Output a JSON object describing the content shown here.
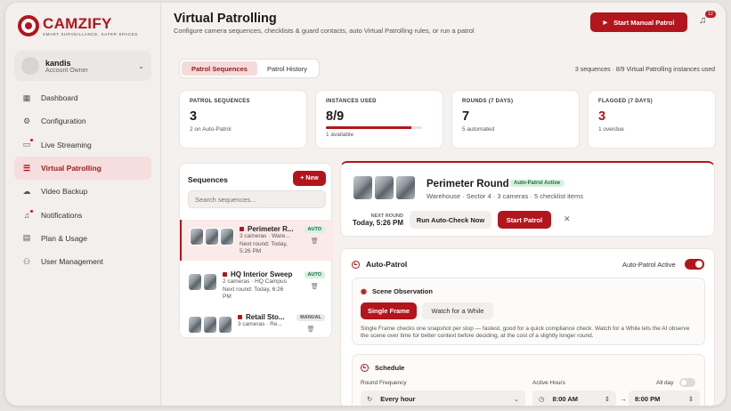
{
  "brand": {
    "name": "CAMZIFY",
    "tagline": "SMART SURVEILLANCE, SAFER SPACES"
  },
  "user": {
    "name": "kandis",
    "role": "Account Owner"
  },
  "nav": [
    {
      "label": "Dashboard",
      "icon": "grid-icon"
    },
    {
      "label": "Configuration",
      "icon": "gear-icon"
    },
    {
      "label": "Live Streaming",
      "icon": "video-icon"
    },
    {
      "label": "Virtual Patrolling",
      "icon": "stack-icon",
      "active": true
    },
    {
      "label": "Video Backup",
      "icon": "cloud-icon"
    },
    {
      "label": "Notifications",
      "icon": "bell-icon"
    },
    {
      "label": "Plan & Usage",
      "icon": "document-icon"
    },
    {
      "label": "User Management",
      "icon": "users-icon"
    }
  ],
  "header": {
    "title": "Virtual Patrolling",
    "subtitle": "Configure camera sequences, checklists & guard contacts, auto Virtual Patrolling rules, or run a patrol",
    "start_manual": "Start Manual Patrol",
    "notif_count": "12"
  },
  "tabs": [
    "Patrol Sequences",
    "Patrol History"
  ],
  "meta": "3 sequences · 8/9 Virtual Patrolling instances used",
  "stats": [
    {
      "label": "PATROL SEQUENCES",
      "value": "3",
      "sub": "2 on Auto-Patrol"
    },
    {
      "label": "INSTANCES USED",
      "value": "8/9",
      "sub": "1 available",
      "progress": 0.89
    },
    {
      "label": "ROUNDS (7 DAYS)",
      "value": "7",
      "sub": "5 automated"
    },
    {
      "label": "FLAGGED (7 DAYS)",
      "value": "3",
      "sub": "1 overdue"
    }
  ],
  "sequences": {
    "title": "Sequences",
    "new_label": "+ New",
    "search_placeholder": "Search sequences...",
    "items": [
      {
        "name": "Perimeter R...",
        "details": [
          "3 cameras · Ware...",
          "Next round: Today,",
          "5:26 PM"
        ],
        "badge": "AUTO"
      },
      {
        "name": "HQ Interior Sweep",
        "details": [
          "2 cameras · HQ Campus",
          "Next round: Today, 6:26",
          "PM"
        ],
        "badge": "AUTO"
      },
      {
        "name": "Retail Sto...",
        "details": [
          "3 cameras · Re..."
        ],
        "badge": "MANUAL"
      }
    ]
  },
  "detail": {
    "name": "Perimeter Round",
    "badge": "Auto-Patrol Active",
    "sub": "Warehouse · Sector 4 · 3 cameras · 5 checklist items",
    "next_label": "NEXT ROUND",
    "next_value": "Today, 5:26 PM",
    "run_check": "Run Auto-Check Now",
    "start": "Start Patrol",
    "close": "✕"
  },
  "autopatrol": {
    "title": "Auto-Patrol",
    "toggle_label": "Auto-Patrol Active",
    "scene": {
      "title": "Scene Observation",
      "single": "Single Frame",
      "watch": "Watch for a While",
      "desc": "Single Frame checks one snapshot per stop — fastest, good for a quick compliance check. Watch for a While lets the AI observe the scene over time for better context before deciding, at the cost of a slightly longer round."
    },
    "schedule": {
      "title": "Schedule",
      "freq_label": "Round Frequency",
      "freq_value": "Every hour",
      "hours_label": "Active Hours",
      "allday_label": "All day",
      "from": "8:00 AM",
      "to": "8:00 PM",
      "arrow": "→"
    }
  }
}
